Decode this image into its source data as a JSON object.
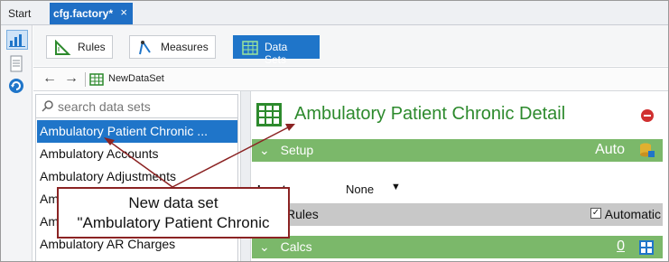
{
  "tabs": {
    "start": "Start",
    "active": "cfg.factory*",
    "close_glyph": "×"
  },
  "toolbar": {
    "rules": "Rules",
    "measures": "Measures",
    "datasets": "Data Sets"
  },
  "nav": {
    "back": "←",
    "forward": "→",
    "new_dataset": "NewDataSet"
  },
  "search": {
    "placeholder": "search data sets"
  },
  "list": {
    "items": [
      "Ambulatory Patient Chronic ...",
      "Ambulatory Accounts",
      "Ambulatory Adjustments",
      "Am",
      "Am",
      "Ambulatory AR Charges"
    ]
  },
  "detail": {
    "title": "Ambulatory Patient Chronic Detail",
    "setup": {
      "label": "Setup",
      "value": "Auto"
    },
    "input": {
      "label": "Input:",
      "value": "None"
    },
    "rules": {
      "label": "Rules",
      "checkbox_label": "Automatic",
      "checked": true
    },
    "calcs": {
      "label": "Calcs",
      "value": "0"
    }
  },
  "callout": {
    "line1": "New data set",
    "line2": "\"Ambulatory Patient Chronic"
  },
  "colors": {
    "accent": "#1f75c9",
    "section_green": "#7bb86a",
    "title_green": "#2d8a2d",
    "callout_border": "#8b2323"
  }
}
